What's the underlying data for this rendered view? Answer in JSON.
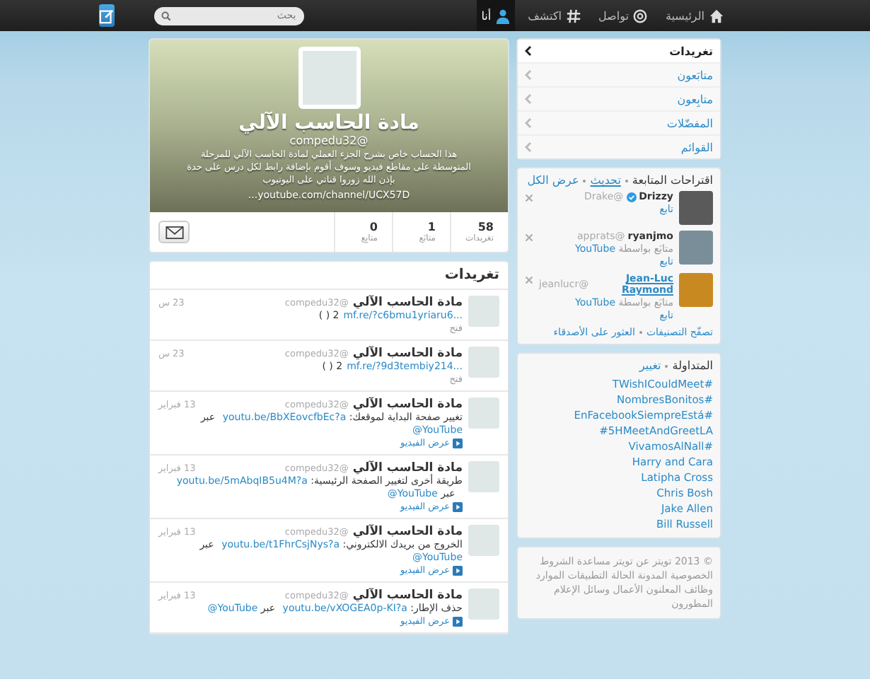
{
  "top_nav": [
    {
      "kind": "home",
      "label": "الرئيسية",
      "selected": false
    },
    {
      "kind": "connect",
      "label": "تواصل",
      "selected": false
    },
    {
      "kind": "discover",
      "label": "اكتشف",
      "selected": false
    },
    {
      "kind": "me",
      "label": "أنا",
      "selected": true
    }
  ],
  "search": {
    "placeholder": "بحث"
  },
  "profile": {
    "name": "مادة الحاسب الآلي",
    "handle": "@compedu32",
    "bio": "هذا الحساب خاص بشرح الجزء العملي لمادة الحاسب الآلي للمرحلة المتوسطة على مقاطع فيديو وسوف أقوم بإضافة رابط لكل درس على حدة بإذن الله زوروا قناتي على اليوتيوب",
    "url": "youtube.com/channel/UCX57D...",
    "stats": [
      {
        "value": "58",
        "label": "تغريدات"
      },
      {
        "value": "1",
        "label": "متابَع"
      },
      {
        "value": "0",
        "label": "متابِع"
      }
    ]
  },
  "profile_nav": [
    {
      "label": "تغريدات",
      "selected": true
    },
    {
      "label": "متابَعون",
      "selected": false
    },
    {
      "label": "متابِعون",
      "selected": false
    },
    {
      "label": "المفضّلات",
      "selected": false
    },
    {
      "label": "القوائم",
      "selected": false
    }
  ],
  "suggestions": {
    "title": "اقتراحات المتابعة",
    "refresh": "تحديث",
    "view_all": "عرض الكل",
    "users": [
      {
        "name": "Drizzy",
        "handle": "@Drake",
        "verified": true,
        "follow": "تابع"
      },
      {
        "name": "ryanjmo",
        "handle": "@apprats",
        "verified": false,
        "followed_by_label": "متابَع بواسطة",
        "followed_by": "YouTube",
        "follow": "تابع"
      },
      {
        "name": "Jean-Luc Raymond",
        "handle": "@jeanlucr",
        "verified": false,
        "followed_by_label": "متابَع بواسطة",
        "followed_by": "YouTube",
        "follow": "تابع"
      }
    ],
    "browse": "تصفّح التصنيفات",
    "find_friends": "العثور على الأصدقاء"
  },
  "trends": {
    "title": "المتداولة",
    "change": "تغيير",
    "items": [
      "TWishICouldMeet#",
      "NombresBonitos#",
      "EnFacebookSiempreEstá#",
      "#5HMeetAndGreetLA",
      "VivamosAlNall#",
      "Harry and Cara",
      "Latipha Cross",
      "Chris Bosh",
      "Jake Allen",
      "Bill Russell"
    ]
  },
  "footer": "© 2013 تويتر  عن تويتر  مساعدة  الشروط  الخصوصية  المدونة  الحالة  التطبيقات  الموارد  وظائف  المعلنون  الأعمال  وسائل الإعلام  المطورون",
  "timeline": {
    "title": "تغريدات",
    "tweets": [
      {
        "name": "مادة الحاسب الآلي",
        "handle": "@compedu32",
        "time": "23 س",
        "parts": [
          {
            "kind": "link",
            "text": "mf.re/?c6bmu1yriaru6..."
          },
          {
            "kind": "text",
            "text": "( ) 2"
          }
        ],
        "action": {
          "kind": "open",
          "label": "فتح"
        }
      },
      {
        "name": "مادة الحاسب الآلي",
        "handle": "@compedu32",
        "time": "23 س",
        "parts": [
          {
            "kind": "link",
            "text": "mf.re/?9d3tembiy214..."
          },
          {
            "kind": "text",
            "text": "( ) 2"
          }
        ],
        "action": {
          "kind": "open",
          "label": "فتح"
        }
      },
      {
        "name": "مادة الحاسب الآلي",
        "handle": "@compedu32",
        "time": "13 فبراير",
        "parts": [
          {
            "kind": "text",
            "text": "تغيير صفحة البداية لموقعك: "
          },
          {
            "kind": "link",
            "text": "youtu.be/BbXEovcfbEc?a"
          },
          {
            "kind": "text",
            "text": " عبر "
          },
          {
            "kind": "link",
            "text": "@YouTube"
          }
        ],
        "action": {
          "kind": "video",
          "label": "عرض الفيديو"
        }
      },
      {
        "name": "مادة الحاسب الآلي",
        "handle": "@compedu32",
        "time": "13 فبراير",
        "parts": [
          {
            "kind": "text",
            "text": "طريقة أخرى لتغيير الصفحة الرئيسية: "
          },
          {
            "kind": "link",
            "text": "youtu.be/5mAbqIB5u4M?a"
          },
          {
            "kind": "text",
            "text": " عبر "
          },
          {
            "kind": "link",
            "text": "@YouTube"
          }
        ],
        "action": {
          "kind": "video",
          "label": "عرض الفيديو"
        }
      },
      {
        "name": "مادة الحاسب الآلي",
        "handle": "@compedu32",
        "time": "13 فبراير",
        "parts": [
          {
            "kind": "text",
            "text": "الخروج من بريدك الالكتروني: "
          },
          {
            "kind": "link",
            "text": "youtu.be/t1FhrCsjNys?a"
          },
          {
            "kind": "text",
            "text": " عبر "
          },
          {
            "kind": "link",
            "text": "@YouTube"
          }
        ],
        "action": {
          "kind": "video",
          "label": "عرض الفيديو"
        }
      },
      {
        "name": "مادة الحاسب الآلي",
        "handle": "@compedu32",
        "time": "13 فبراير",
        "parts": [
          {
            "kind": "text",
            "text": "حذف الإطار: "
          },
          {
            "kind": "link",
            "text": "youtu.be/vXOGEA0p-KI?a"
          },
          {
            "kind": "text",
            "text": " عبر "
          },
          {
            "kind": "link",
            "text": "@YouTube"
          }
        ],
        "action": {
          "kind": "video",
          "label": "عرض الفيديو"
        }
      }
    ]
  }
}
